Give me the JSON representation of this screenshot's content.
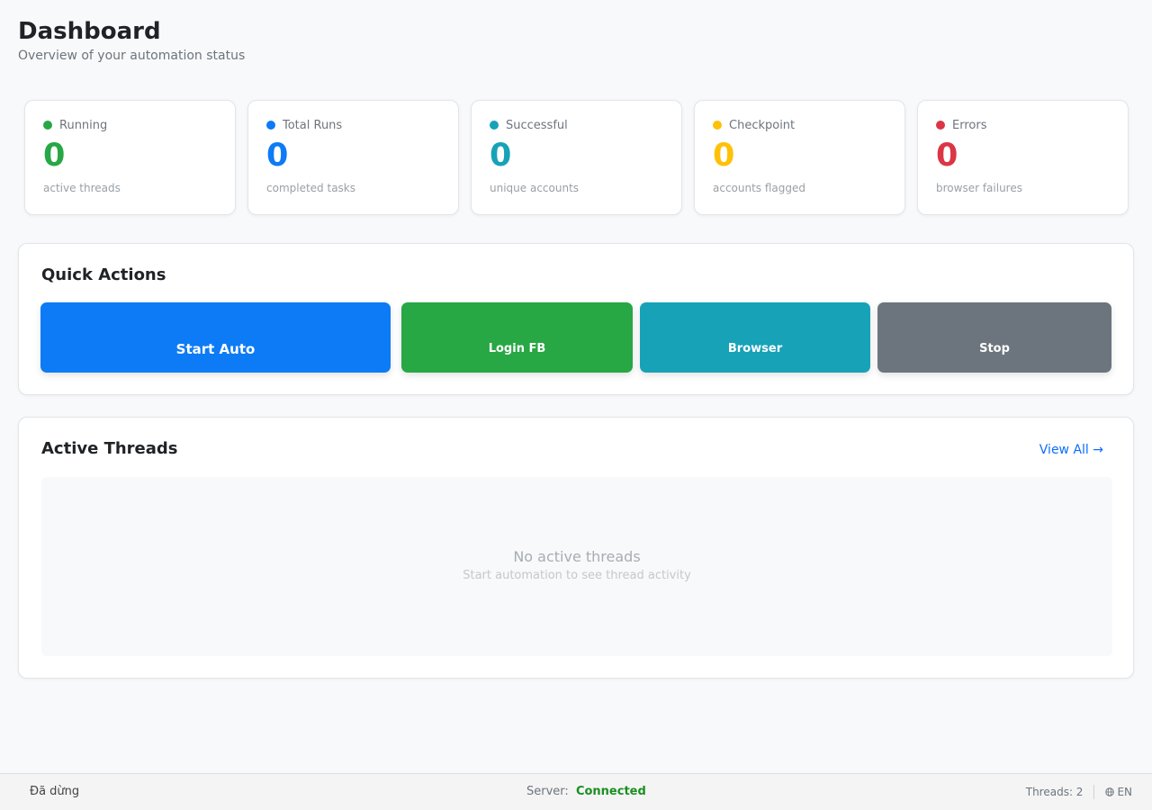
{
  "header": {
    "title": "Dashboard",
    "subtitle": "Overview of your automation status"
  },
  "stats": [
    {
      "label": "Running",
      "value": "0",
      "desc": "active threads",
      "color": "#28a745"
    },
    {
      "label": "Total Runs",
      "value": "0",
      "desc": "completed tasks",
      "color": "#0d7bf5"
    },
    {
      "label": "Successful",
      "value": "0",
      "desc": "unique accounts",
      "color": "#17a2b8"
    },
    {
      "label": "Checkpoint",
      "value": "0",
      "desc": "accounts flagged",
      "color": "#ffc107"
    },
    {
      "label": "Errors",
      "value": "0",
      "desc": "browser failures",
      "color": "#dc3545"
    }
  ],
  "quick_actions": {
    "title": "Quick Actions",
    "buttons": [
      {
        "label": "Start Auto",
        "color": "#0d7bf5"
      },
      {
        "label": "Login FB",
        "color": "#28a745"
      },
      {
        "label": "Browser",
        "color": "#17a2b8"
      },
      {
        "label": "Stop",
        "color": "#6c757d"
      }
    ]
  },
  "active_threads": {
    "title": "Active Threads",
    "view_all": "View All →",
    "empty_title": "No active threads",
    "empty_desc": "Start automation to see thread activity"
  },
  "status_bar": {
    "state": "Đã dừng",
    "server_label": "Server:",
    "server_status": "Connected",
    "threads": "Threads: 2",
    "language": "EN",
    "language_icon": "globe-icon"
  }
}
